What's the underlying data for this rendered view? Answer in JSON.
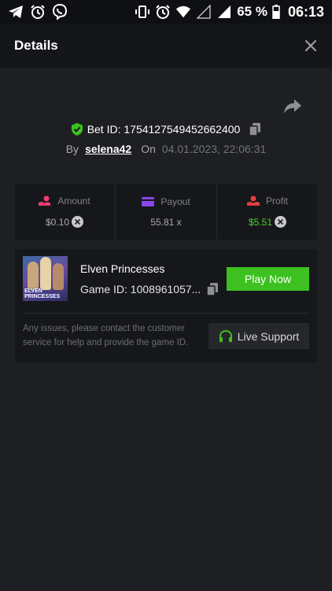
{
  "status_bar": {
    "battery_percent": "65 %",
    "time": "06:13",
    "left_icons": [
      "telegram-icon",
      "alarm-icon",
      "viber-icon"
    ],
    "right_icons": [
      "vibrate-icon",
      "alarm-icon",
      "wifi-icon",
      "signal-empty-icon",
      "signal-icon",
      "battery-icon"
    ]
  },
  "header": {
    "title": "Details"
  },
  "bet": {
    "id_label": "Bet ID: 1754127549452662400",
    "by_label": "By",
    "username": "selena42",
    "on_label": "On",
    "date": "04.01.2023, 22:06:31"
  },
  "stats": {
    "amount": {
      "label": "Amount",
      "value": "$0.10",
      "icon": "hand-coin-icon"
    },
    "payout": {
      "label": "Payout",
      "value": "55.81 x",
      "icon": "card-icon"
    },
    "profit": {
      "label": "Profit",
      "value": "$5.51",
      "icon": "profit-icon"
    }
  },
  "game": {
    "thumb_text": "ELVEN PRINCESSES",
    "name": "Elven Princesses",
    "game_id": "Game ID: 1008961057...",
    "play_label": "Play Now",
    "support_text": "Any issues, please contact the customer service for help and provide the game ID.",
    "support_label": "Live Support"
  },
  "colors": {
    "background": "#1e1f22",
    "card": "#16171b",
    "accent_green": "#3cc120",
    "profit_green": "#4bd12b",
    "payout_purple": "#8a46e8",
    "amount_pink": "#f03b6e",
    "profit_red": "#e83d3d"
  }
}
